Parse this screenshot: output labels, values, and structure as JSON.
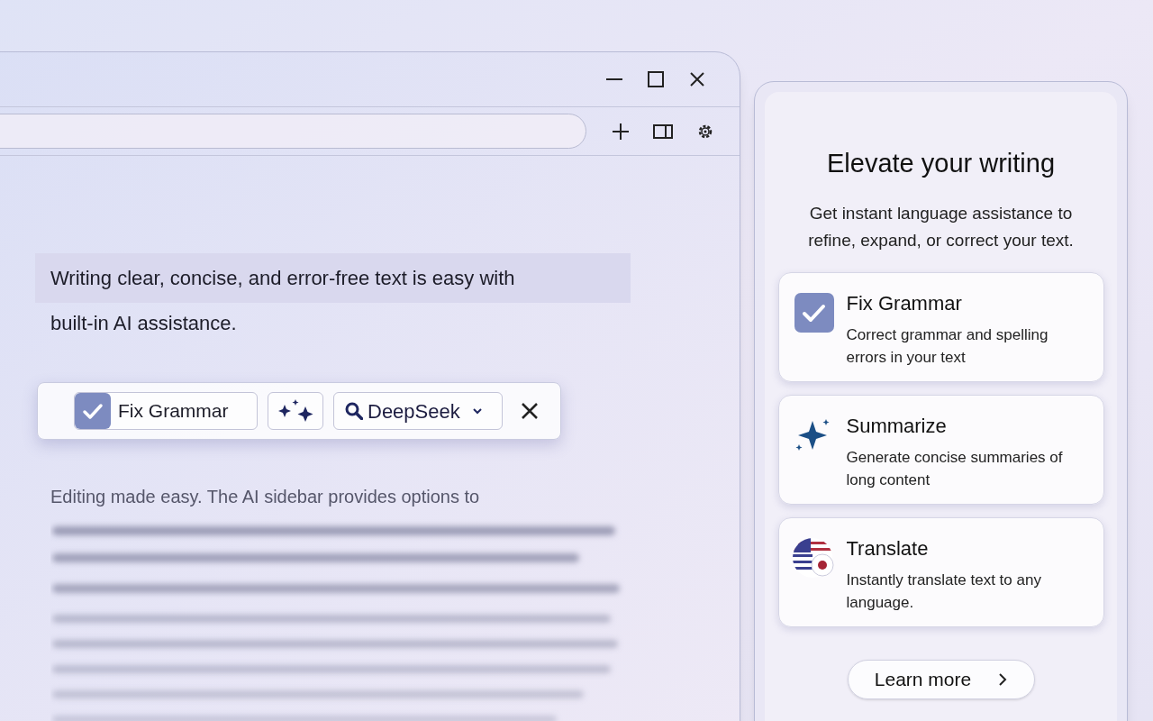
{
  "document": {
    "lines": [
      {
        "text": "Writing clear, concise, and error-free text is easy with",
        "highlighted": true
      },
      {
        "text": "built-in AI assistance.",
        "highlighted": false
      }
    ],
    "paragraph": "Editing made easy. The AI sidebar provides options to"
  },
  "floating_toolbar": {
    "action": "Fix Grammar",
    "model": "DeepSeek"
  },
  "sidebar": {
    "title": "Elevate your writing",
    "description": "Get instant language assistance to refine, expand, or correct your text.",
    "features": [
      {
        "kind": "grammar",
        "title": "Fix Grammar",
        "description": "Correct grammar and spelling errors in your text"
      },
      {
        "kind": "summarize",
        "title": "Summarize",
        "description": "Generate concise summaries of long content"
      },
      {
        "kind": "translate",
        "title": "Translate",
        "description": "Instantly translate text to any language."
      }
    ],
    "button": "Learn more"
  }
}
